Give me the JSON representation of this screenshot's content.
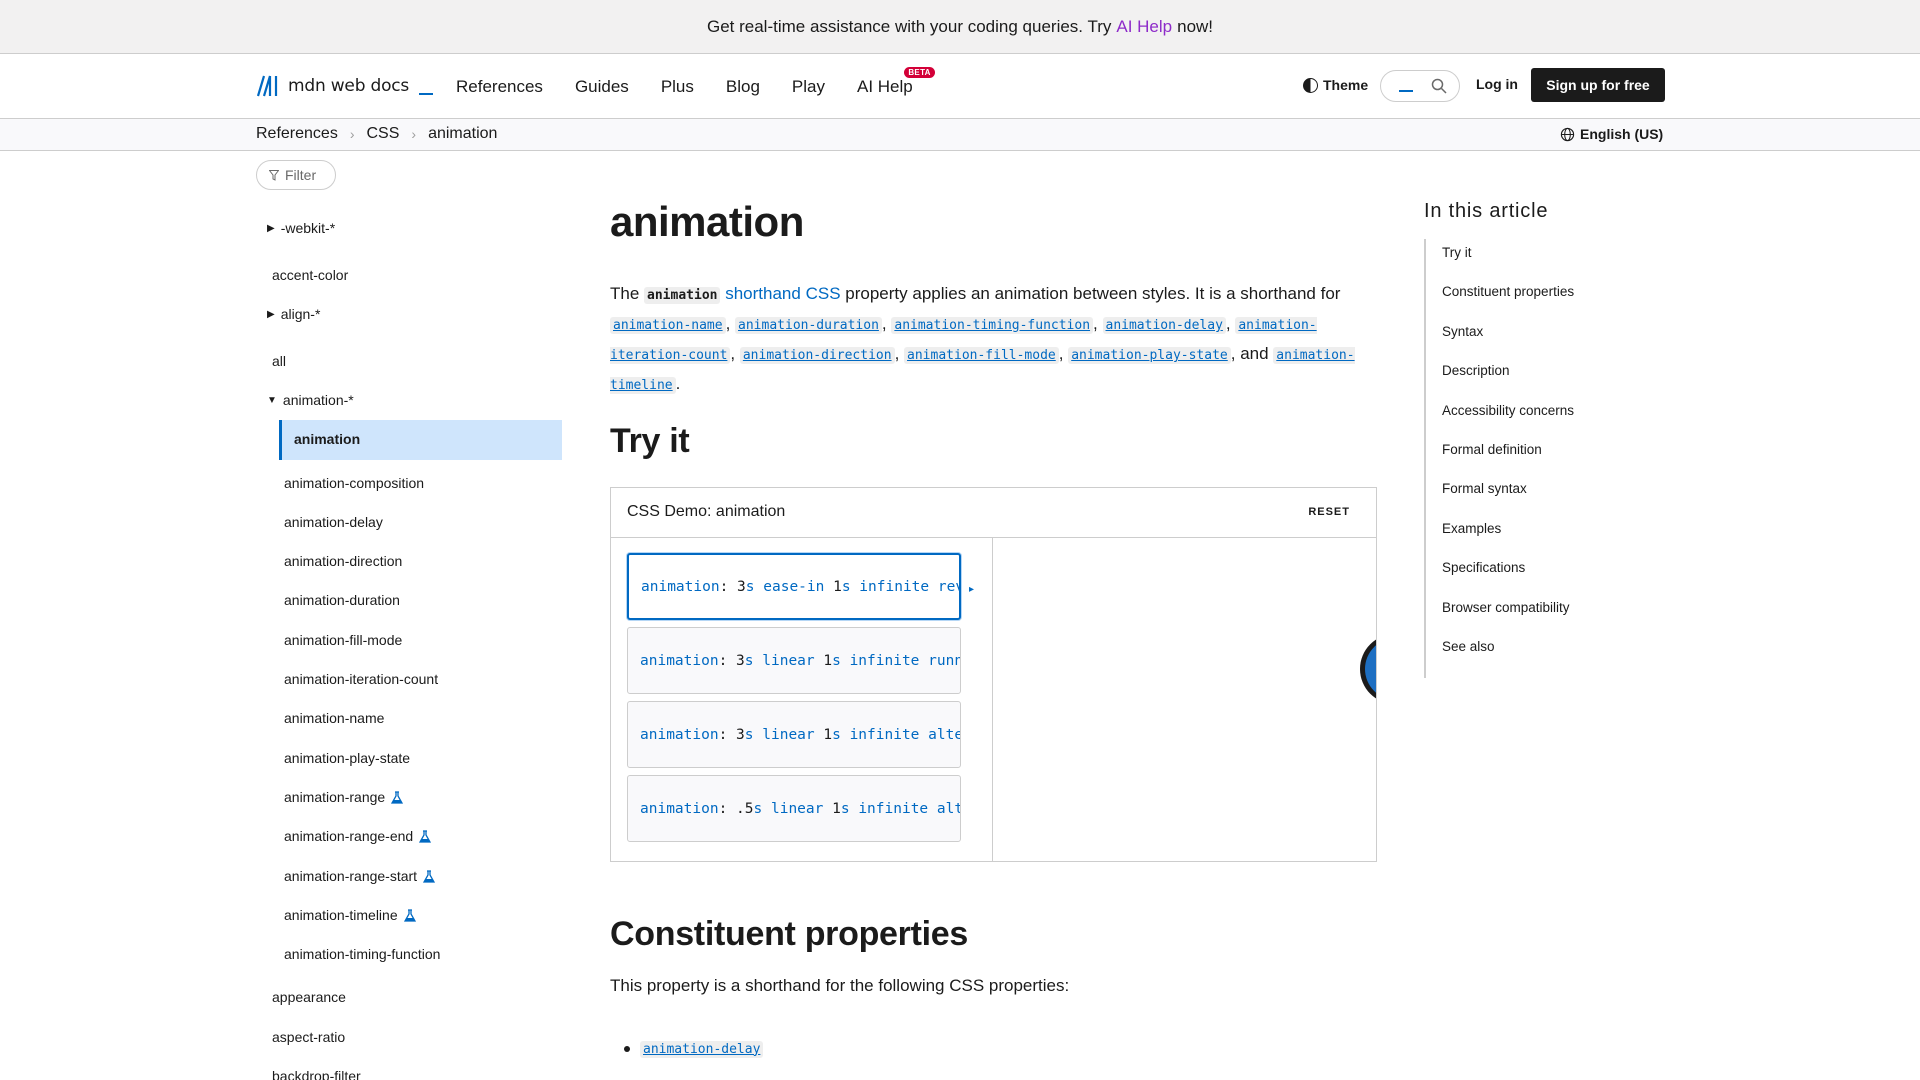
{
  "banner": {
    "text": "Get real-time assistance with your coding queries. Try",
    "link": "AI Help",
    "suffix": "now!"
  },
  "header": {
    "logo_text": "mdn web docs",
    "nav": [
      "References",
      "Guides",
      "Plus",
      "Blog",
      "Play",
      "AI Help"
    ],
    "beta_badge": "BETA",
    "theme_label": "Theme",
    "login": "Log in",
    "signup": "Sign up for free"
  },
  "breadcrumbs": [
    "References",
    "CSS",
    "animation"
  ],
  "language": "English (US)",
  "sidebar": {
    "filter_placeholder": "Filter",
    "items": [
      {
        "label": "-webkit-*",
        "caret": "▶"
      },
      {
        "label": "accent-color"
      },
      {
        "label": "align-*",
        "caret": "▶"
      },
      {
        "label": "all"
      },
      {
        "label": "animation-*",
        "caret": "▼"
      },
      {
        "label": "animation",
        "active": true
      },
      {
        "label": "animation-composition"
      },
      {
        "label": "animation-delay"
      },
      {
        "label": "animation-direction"
      },
      {
        "label": "animation-duration"
      },
      {
        "label": "animation-fill-mode"
      },
      {
        "label": "animation-iteration-count"
      },
      {
        "label": "animation-name"
      },
      {
        "label": "animation-play-state"
      },
      {
        "label": "animation-range",
        "experimental": true
      },
      {
        "label": "animation-range-end",
        "experimental": true
      },
      {
        "label": "animation-range-start",
        "experimental": true
      },
      {
        "label": "animation-timeline",
        "experimental": true
      },
      {
        "label": "animation-timing-function"
      },
      {
        "label": "appearance"
      },
      {
        "label": "aspect-ratio"
      },
      {
        "label": "backdrop-filter"
      }
    ]
  },
  "main": {
    "title": "animation",
    "intro": {
      "the": "The",
      "code": "animation",
      "link1": "shorthand",
      "link2": "CSS",
      "text": "property applies an animation between styles. It is a shorthand for",
      "props": [
        "animation-name",
        "animation-duration",
        "animation-timing-function",
        "animation-delay",
        "animation-iteration-count",
        "animation-direction",
        "animation-fill-mode",
        "animation-play-state",
        "animation-timeline"
      ],
      "and": ", and"
    },
    "try_it": "Try it",
    "demo": {
      "title": "CSS Demo: animation",
      "reset": "RESET",
      "choices": [
        {
          "prop": "animation",
          "num1": "3",
          "u1": "s",
          "fn": "ease-in",
          "num2": "1",
          "u2": "s",
          "rest": "infinite reverse both running slidein"
        },
        {
          "prop": "animation",
          "num1": "3",
          "u1": "s",
          "fn": "linear",
          "num2": "1",
          "u2": "s",
          "rest": "infinite running slidein"
        },
        {
          "prop": "animation",
          "num1": "3",
          "u1": "s",
          "fn": "linear",
          "num2": "1",
          "u2": "s",
          "rest": "infinite alternate slidein"
        },
        {
          "prop": "animation",
          "num1": ".5",
          "u1": "s",
          "fn": "linear",
          "num2": "1",
          "u2": "s",
          "rest": "infinite alternate slidein"
        }
      ]
    },
    "constituent_heading": "Constituent properties",
    "constituent_text": "This property is a shorthand for the following CSS properties:",
    "bullets": [
      "animation-delay"
    ]
  },
  "toc": {
    "title": "In this article",
    "items": [
      "Try it",
      "Constituent properties",
      "Syntax",
      "Description",
      "Accessibility concerns",
      "Formal definition",
      "Formal syntax",
      "Examples",
      "Specifications",
      "Browser compatibility",
      "See also"
    ]
  },
  "colors": {
    "link": "#0069c2",
    "ai_help": "#8e2bc9",
    "active_bg": "#cfe5fc",
    "beta": "#d30038"
  }
}
